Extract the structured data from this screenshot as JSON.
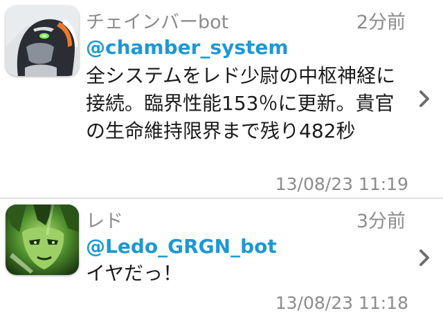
{
  "tweets": [
    {
      "display_name": "チェインバーbot",
      "screen_name": "@chamber_system",
      "relative_time": "2分前",
      "text": "全システムをレド少尉の中枢神経に接続。臨界性能153％に更新。貴官の生命維持限界まで残り482秒",
      "timestamp": "13/08/23 11:19",
      "avatar_icon": "robot-avatar-icon"
    },
    {
      "display_name": "レド",
      "screen_name": "@Ledo_GRGN_bot",
      "relative_time": "3分前",
      "text": "イヤだっ！",
      "timestamp": "13/08/23 11:18",
      "avatar_icon": "character-avatar-icon"
    }
  ],
  "colors": {
    "screen_name": "#1e98d4",
    "meta_text": "#8c8c8c",
    "body_text": "#1a1a1a",
    "separator": "#dddddd"
  },
  "icons": {
    "disclosure": "chevron-right-icon"
  }
}
